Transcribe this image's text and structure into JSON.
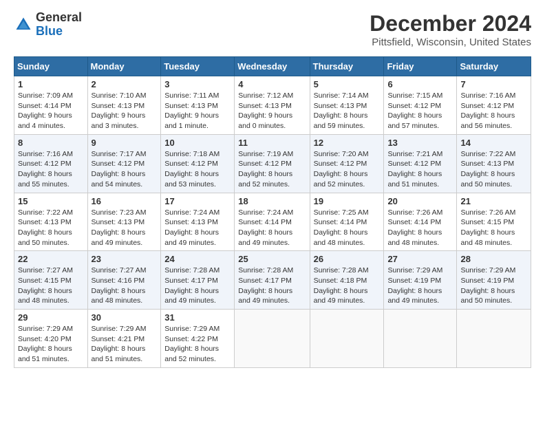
{
  "header": {
    "logo_general": "General",
    "logo_blue": "Blue",
    "month_title": "December 2024",
    "location": "Pittsfield, Wisconsin, United States"
  },
  "weekdays": [
    "Sunday",
    "Monday",
    "Tuesday",
    "Wednesday",
    "Thursday",
    "Friday",
    "Saturday"
  ],
  "weeks": [
    [
      {
        "day": "1",
        "sunrise": "Sunrise: 7:09 AM",
        "sunset": "Sunset: 4:14 PM",
        "daylight": "Daylight: 9 hours and 4 minutes."
      },
      {
        "day": "2",
        "sunrise": "Sunrise: 7:10 AM",
        "sunset": "Sunset: 4:13 PM",
        "daylight": "Daylight: 9 hours and 3 minutes."
      },
      {
        "day": "3",
        "sunrise": "Sunrise: 7:11 AM",
        "sunset": "Sunset: 4:13 PM",
        "daylight": "Daylight: 9 hours and 1 minute."
      },
      {
        "day": "4",
        "sunrise": "Sunrise: 7:12 AM",
        "sunset": "Sunset: 4:13 PM",
        "daylight": "Daylight: 9 hours and 0 minutes."
      },
      {
        "day": "5",
        "sunrise": "Sunrise: 7:14 AM",
        "sunset": "Sunset: 4:13 PM",
        "daylight": "Daylight: 8 hours and 59 minutes."
      },
      {
        "day": "6",
        "sunrise": "Sunrise: 7:15 AM",
        "sunset": "Sunset: 4:12 PM",
        "daylight": "Daylight: 8 hours and 57 minutes."
      },
      {
        "day": "7",
        "sunrise": "Sunrise: 7:16 AM",
        "sunset": "Sunset: 4:12 PM",
        "daylight": "Daylight: 8 hours and 56 minutes."
      }
    ],
    [
      {
        "day": "8",
        "sunrise": "Sunrise: 7:16 AM",
        "sunset": "Sunset: 4:12 PM",
        "daylight": "Daylight: 8 hours and 55 minutes."
      },
      {
        "day": "9",
        "sunrise": "Sunrise: 7:17 AM",
        "sunset": "Sunset: 4:12 PM",
        "daylight": "Daylight: 8 hours and 54 minutes."
      },
      {
        "day": "10",
        "sunrise": "Sunrise: 7:18 AM",
        "sunset": "Sunset: 4:12 PM",
        "daylight": "Daylight: 8 hours and 53 minutes."
      },
      {
        "day": "11",
        "sunrise": "Sunrise: 7:19 AM",
        "sunset": "Sunset: 4:12 PM",
        "daylight": "Daylight: 8 hours and 52 minutes."
      },
      {
        "day": "12",
        "sunrise": "Sunrise: 7:20 AM",
        "sunset": "Sunset: 4:12 PM",
        "daylight": "Daylight: 8 hours and 52 minutes."
      },
      {
        "day": "13",
        "sunrise": "Sunrise: 7:21 AM",
        "sunset": "Sunset: 4:12 PM",
        "daylight": "Daylight: 8 hours and 51 minutes."
      },
      {
        "day": "14",
        "sunrise": "Sunrise: 7:22 AM",
        "sunset": "Sunset: 4:13 PM",
        "daylight": "Daylight: 8 hours and 50 minutes."
      }
    ],
    [
      {
        "day": "15",
        "sunrise": "Sunrise: 7:22 AM",
        "sunset": "Sunset: 4:13 PM",
        "daylight": "Daylight: 8 hours and 50 minutes."
      },
      {
        "day": "16",
        "sunrise": "Sunrise: 7:23 AM",
        "sunset": "Sunset: 4:13 PM",
        "daylight": "Daylight: 8 hours and 49 minutes."
      },
      {
        "day": "17",
        "sunrise": "Sunrise: 7:24 AM",
        "sunset": "Sunset: 4:13 PM",
        "daylight": "Daylight: 8 hours and 49 minutes."
      },
      {
        "day": "18",
        "sunrise": "Sunrise: 7:24 AM",
        "sunset": "Sunset: 4:14 PM",
        "daylight": "Daylight: 8 hours and 49 minutes."
      },
      {
        "day": "19",
        "sunrise": "Sunrise: 7:25 AM",
        "sunset": "Sunset: 4:14 PM",
        "daylight": "Daylight: 8 hours and 48 minutes."
      },
      {
        "day": "20",
        "sunrise": "Sunrise: 7:26 AM",
        "sunset": "Sunset: 4:14 PM",
        "daylight": "Daylight: 8 hours and 48 minutes."
      },
      {
        "day": "21",
        "sunrise": "Sunrise: 7:26 AM",
        "sunset": "Sunset: 4:15 PM",
        "daylight": "Daylight: 8 hours and 48 minutes."
      }
    ],
    [
      {
        "day": "22",
        "sunrise": "Sunrise: 7:27 AM",
        "sunset": "Sunset: 4:15 PM",
        "daylight": "Daylight: 8 hours and 48 minutes."
      },
      {
        "day": "23",
        "sunrise": "Sunrise: 7:27 AM",
        "sunset": "Sunset: 4:16 PM",
        "daylight": "Daylight: 8 hours and 48 minutes."
      },
      {
        "day": "24",
        "sunrise": "Sunrise: 7:28 AM",
        "sunset": "Sunset: 4:17 PM",
        "daylight": "Daylight: 8 hours and 49 minutes."
      },
      {
        "day": "25",
        "sunrise": "Sunrise: 7:28 AM",
        "sunset": "Sunset: 4:17 PM",
        "daylight": "Daylight: 8 hours and 49 minutes."
      },
      {
        "day": "26",
        "sunrise": "Sunrise: 7:28 AM",
        "sunset": "Sunset: 4:18 PM",
        "daylight": "Daylight: 8 hours and 49 minutes."
      },
      {
        "day": "27",
        "sunrise": "Sunrise: 7:29 AM",
        "sunset": "Sunset: 4:19 PM",
        "daylight": "Daylight: 8 hours and 49 minutes."
      },
      {
        "day": "28",
        "sunrise": "Sunrise: 7:29 AM",
        "sunset": "Sunset: 4:19 PM",
        "daylight": "Daylight: 8 hours and 50 minutes."
      }
    ],
    [
      {
        "day": "29",
        "sunrise": "Sunrise: 7:29 AM",
        "sunset": "Sunset: 4:20 PM",
        "daylight": "Daylight: 8 hours and 51 minutes."
      },
      {
        "day": "30",
        "sunrise": "Sunrise: 7:29 AM",
        "sunset": "Sunset: 4:21 PM",
        "daylight": "Daylight: 8 hours and 51 minutes."
      },
      {
        "day": "31",
        "sunrise": "Sunrise: 7:29 AM",
        "sunset": "Sunset: 4:22 PM",
        "daylight": "Daylight: 8 hours and 52 minutes."
      },
      null,
      null,
      null,
      null
    ]
  ]
}
